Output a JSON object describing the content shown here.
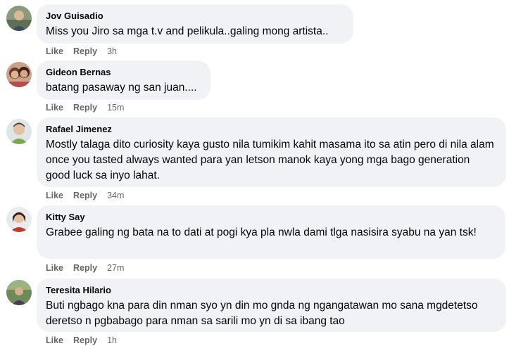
{
  "comments": [
    {
      "author": "Jov Guisadio",
      "text": "Miss you Jiro sa mga t.v and pelikula..galing mong artista..",
      "like": "Like",
      "reply": "Reply",
      "time": "3h"
    },
    {
      "author": "Gideon Bernas",
      "text": "batang pasaway ng san juan....",
      "like": "Like",
      "reply": "Reply",
      "time": "15m"
    },
    {
      "author": "Rafael Jimenez",
      "text": "Mostly talaga dito curiosity kaya gusto nila tumikim kahit masama ito sa atin pero di nila alam once you tasted always wanted para yan letson manok kaya yong mga bago generation good luck sa inyo lahat.",
      "like": "Like",
      "reply": "Reply",
      "time": "34m"
    },
    {
      "author": "Kitty Say",
      "text": "Grabee galing ng bata na to dati at pogi kya pla nwla dami tlga nasisira syabu na yan tsk!",
      "like": "Like",
      "reply": "Reply",
      "time": "27m"
    },
    {
      "author": "Teresita Hilario",
      "text": "Buti ngbago kna para din nman syo yn din mo gnda ng ngangatawan mo sana mgdetetso deretso n pgbabago para nman sa sarili mo yn di sa ibang tao",
      "like": "Like",
      "reply": "Reply",
      "time": "1h"
    }
  ],
  "colors": {
    "bubble": "#f0f2f5",
    "author": "#050505",
    "action": "#65676b"
  },
  "icons": [
    "avatar-jov",
    "avatar-gideon",
    "avatar-rafael",
    "avatar-kitty",
    "avatar-teresita"
  ]
}
